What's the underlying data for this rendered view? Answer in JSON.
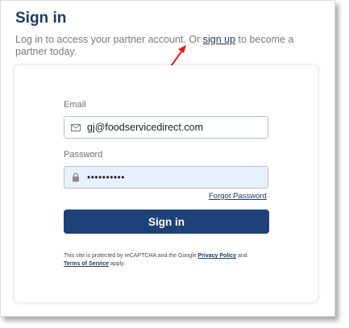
{
  "page": {
    "title": "Sign in",
    "intro_before": "Log in to access your partner account. Or ",
    "intro_link": "sign up",
    "intro_after": " to become a partner today."
  },
  "form": {
    "email_label": "Email",
    "email_value": "gj@foodservicedirect.com",
    "password_label": "Password",
    "password_value": "••••••••••",
    "forgot_label": "Forgot Password",
    "submit_label": "Sign in"
  },
  "legal": {
    "text_before": "This site is protected by reCAPTCHA and the Google ",
    "privacy_label": "Privacy Policy",
    "text_middle": " and ",
    "terms_label": "Terms of Service",
    "text_after": " apply."
  },
  "icons": {
    "email_field_icon": "envelope-icon",
    "password_field_icon": "lock-icon",
    "annotation_icon": "red-arrow-icon"
  },
  "colors": {
    "brand_navy": "#1e4278",
    "title_text": "#1f3a60",
    "autofill_bg": "#e8f0fe",
    "annotation_red": "#e02020"
  }
}
